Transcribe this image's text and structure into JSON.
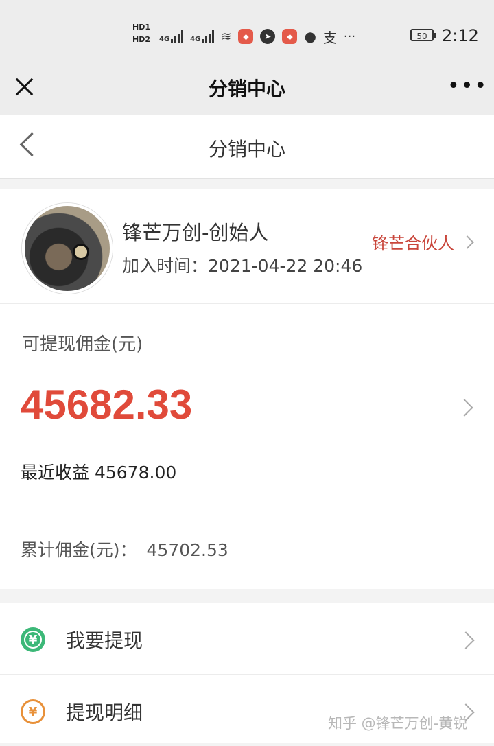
{
  "status_bar": {
    "hd1": "HD1",
    "hd2": "HD2",
    "signal1": "4G",
    "signal2": "4G",
    "battery": "50",
    "time": "2:12",
    "more": "···"
  },
  "wechat_bar": {
    "title": "分销中心",
    "more": "•••"
  },
  "header": {
    "title": "分销中心"
  },
  "profile": {
    "name": "锋芒万创-创始人",
    "join_label": "加入时间：",
    "join_time": "2021-04-22 20:46",
    "partner_label": "锋芒合伙人"
  },
  "commission": {
    "label": "可提现佣金(元)",
    "amount": "45682.33",
    "recent_label": "最近收益",
    "recent_value": "45678.00",
    "total_label": "累计佣金(元)：",
    "total_value": "45702.53"
  },
  "menu": {
    "items": [
      {
        "label": "我要提现",
        "icon": "withdraw-coin-icon",
        "color": "#3cb878"
      },
      {
        "label": "提现明细",
        "icon": "yuan-cycle-icon",
        "color": "#e8913a"
      }
    ]
  },
  "watermark": "知乎 @锋芒万创-黄锐",
  "colors": {
    "accent_red": "#e04a3a",
    "partner_red": "#c9463b"
  }
}
